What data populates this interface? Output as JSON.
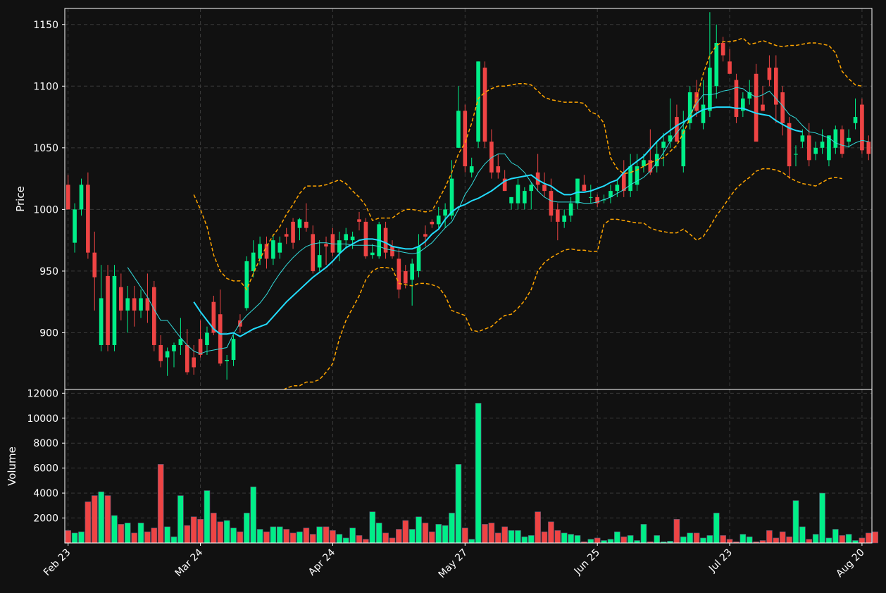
{
  "chart_data": {
    "type": "candlestick",
    "colors": {
      "background": "#111111",
      "up": "#00ee88",
      "down": "#ee4444",
      "grid": "#3a3a3a",
      "axis": "#ffffff",
      "sma_fast": "#33dddd",
      "sma_slow": "#22ddff",
      "bollinger": "#ffa500"
    },
    "price_panel": {
      "ylabel": "Price",
      "yticks": [
        900,
        950,
        1000,
        1050,
        1100,
        1150
      ],
      "ylim": [
        854,
        1163
      ]
    },
    "volume_panel": {
      "ylabel": "Volume",
      "yticks": [
        2000,
        4000,
        6000,
        8000,
        10000,
        12000
      ],
      "ylim": [
        0,
        12300
      ]
    },
    "xlim": [
      -0.5,
      121.5
    ],
    "x_ticks": [
      {
        "index": 0,
        "label": "Feb 23"
      },
      {
        "index": 20,
        "label": "Mar 24"
      },
      {
        "index": 40,
        "label": "Apr 24"
      },
      {
        "index": 60,
        "label": "May 27"
      },
      {
        "index": 80,
        "label": "Jun 25"
      },
      {
        "index": 100,
        "label": "Jul 23"
      },
      {
        "index": 120,
        "label": "Aug 20"
      }
    ],
    "candles": [
      [
        1020,
        1028,
        1000,
        1000
      ],
      [
        973,
        1005,
        965,
        1000
      ],
      [
        1000,
        1025,
        995,
        1020
      ],
      [
        1020,
        1030,
        960,
        965
      ],
      [
        965,
        982,
        918,
        945
      ],
      [
        890,
        955,
        885,
        928
      ],
      [
        946,
        955,
        885,
        890
      ],
      [
        890,
        955,
        885,
        946
      ],
      [
        937,
        948,
        910,
        918
      ],
      [
        918,
        938,
        900,
        928
      ],
      [
        928,
        938,
        905,
        918
      ],
      [
        918,
        935,
        912,
        928
      ],
      [
        928,
        948,
        908,
        918
      ],
      [
        937,
        942,
        885,
        890
      ],
      [
        890,
        898,
        872,
        877
      ],
      [
        880,
        888,
        865,
        885
      ],
      [
        885,
        892,
        872,
        890
      ],
      [
        890,
        912,
        882,
        895
      ],
      [
        890,
        903,
        866,
        868
      ],
      [
        880,
        890,
        866,
        872
      ],
      [
        895,
        910,
        880,
        882
      ],
      [
        890,
        905,
        882,
        900
      ],
      [
        925,
        930,
        898,
        900
      ],
      [
        915,
        935,
        873,
        875
      ],
      [
        877,
        882,
        862,
        878
      ],
      [
        878,
        898,
        873,
        895
      ],
      [
        910,
        915,
        900,
        905
      ],
      [
        920,
        962,
        918,
        958
      ],
      [
        950,
        975,
        945,
        965
      ],
      [
        960,
        978,
        955,
        972
      ],
      [
        972,
        978,
        952,
        960
      ],
      [
        960,
        980,
        955,
        975
      ],
      [
        965,
        978,
        960,
        973
      ],
      [
        980,
        985,
        972,
        978
      ],
      [
        990,
        993,
        968,
        973
      ],
      [
        985,
        993,
        975,
        992
      ],
      [
        990,
        1005,
        982,
        985
      ],
      [
        980,
        987,
        948,
        950
      ],
      [
        953,
        975,
        950,
        963
      ],
      [
        972,
        978,
        955,
        970
      ],
      [
        980,
        985,
        962,
        965
      ],
      [
        965,
        982,
        958,
        975
      ],
      [
        975,
        985,
        968,
        980
      ],
      [
        975,
        982,
        968,
        978
      ],
      [
        992,
        998,
        983,
        990
      ],
      [
        990,
        993,
        960,
        962
      ],
      [
        963,
        972,
        960,
        965
      ],
      [
        962,
        990,
        960,
        988
      ],
      [
        985,
        990,
        960,
        965
      ],
      [
        970,
        975,
        960,
        962
      ],
      [
        960,
        968,
        928,
        935
      ],
      [
        950,
        955,
        936,
        940
      ],
      [
        943,
        960,
        922,
        956
      ],
      [
        950,
        980,
        945,
        970
      ],
      [
        980,
        987,
        970,
        978
      ],
      [
        990,
        992,
        985,
        988
      ],
      [
        988,
        1002,
        985,
        995
      ],
      [
        995,
        1005,
        985,
        1000
      ],
      [
        995,
        1040,
        992,
        1025
      ],
      [
        1050,
        1100,
        1050,
        1080
      ],
      [
        1080,
        1085,
        1030,
        1035
      ],
      [
        1030,
        1042,
        1026,
        1035
      ],
      [
        1055,
        1120,
        1050,
        1120
      ],
      [
        1115,
        1120,
        1050,
        1055
      ],
      [
        1055,
        1065,
        1025,
        1030
      ],
      [
        1035,
        1045,
        1025,
        1030
      ],
      [
        1025,
        1032,
        1015,
        1015
      ],
      [
        1005,
        1010,
        1000,
        1010
      ],
      [
        1005,
        1025,
        1000,
        1020
      ],
      [
        1005,
        1018,
        1000,
        1015
      ],
      [
        1015,
        1022,
        1000,
        1020
      ],
      [
        1030,
        1045,
        1015,
        1020
      ],
      [
        1020,
        1030,
        1010,
        1015
      ],
      [
        1015,
        1025,
        990,
        995
      ],
      [
        1000,
        1005,
        975,
        990
      ],
      [
        990,
        1000,
        985,
        995
      ],
      [
        995,
        1010,
        990,
        1005
      ],
      [
        1005,
        1025,
        1000,
        1025
      ],
      [
        1020,
        1028,
        1015,
        1015
      ],
      [
        1010,
        1020,
        1005,
        1010
      ],
      [
        1010,
        1012,
        1002,
        1005
      ],
      [
        1008,
        1012,
        1005,
        1008
      ],
      [
        1010,
        1020,
        1005,
        1015
      ],
      [
        1015,
        1025,
        1010,
        1020
      ],
      [
        1030,
        1040,
        1010,
        1015
      ],
      [
        1015,
        1045,
        1010,
        1035
      ],
      [
        1020,
        1045,
        1015,
        1035
      ],
      [
        1035,
        1045,
        1030,
        1040
      ],
      [
        1040,
        1065,
        1028,
        1030
      ],
      [
        1035,
        1055,
        1030,
        1045
      ],
      [
        1050,
        1062,
        1035,
        1055
      ],
      [
        1055,
        1090,
        1050,
        1060
      ],
      [
        1075,
        1085,
        1055,
        1055
      ],
      [
        1035,
        1080,
        1030,
        1065
      ],
      [
        1070,
        1100,
        1065,
        1095
      ],
      [
        1095,
        1105,
        1075,
        1080
      ],
      [
        1070,
        1105,
        1065,
        1085
      ],
      [
        1080,
        1160,
        1075,
        1115
      ],
      [
        1100,
        1150,
        1090,
        1135
      ],
      [
        1135,
        1140,
        1120,
        1125
      ],
      [
        1120,
        1130,
        1110,
        1110
      ],
      [
        1105,
        1110,
        1070,
        1075
      ],
      [
        1080,
        1095,
        1075,
        1090
      ],
      [
        1090,
        1105,
        1085,
        1095
      ],
      [
        1110,
        1118,
        1055,
        1055
      ],
      [
        1085,
        1100,
        1080,
        1080
      ],
      [
        1115,
        1125,
        1100,
        1105
      ],
      [
        1115,
        1125,
        1070,
        1085
      ],
      [
        1095,
        1100,
        1060,
        1070
      ],
      [
        1070,
        1075,
        1025,
        1035
      ],
      [
        1045,
        1052,
        1035,
        1045
      ],
      [
        1055,
        1065,
        1050,
        1060
      ],
      [
        1060,
        1070,
        1035,
        1040
      ],
      [
        1045,
        1055,
        1040,
        1050
      ],
      [
        1050,
        1065,
        1045,
        1055
      ],
      [
        1040,
        1060,
        1035,
        1060
      ],
      [
        1050,
        1068,
        1045,
        1065
      ],
      [
        1065,
        1068,
        1042,
        1045
      ],
      [
        1055,
        1065,
        1050,
        1058
      ],
      [
        1070,
        1090,
        1065,
        1075
      ],
      [
        1085,
        1090,
        1045,
        1048
      ],
      [
        1055,
        1060,
        1040,
        1045
      ]
    ],
    "volume": [
      1000,
      800,
      900,
      3300,
      3800,
      4100,
      3800,
      2200,
      1500,
      1600,
      800,
      1600,
      900,
      1200,
      6300,
      1300,
      500,
      3800,
      1400,
      2100,
      1900,
      4200,
      2400,
      1700,
      1800,
      1200,
      900,
      2400,
      4500,
      1100,
      900,
      1300,
      1300,
      1100,
      800,
      900,
      1200,
      700,
      1300,
      1300,
      1000,
      700,
      400,
      1200,
      600,
      300,
      2500,
      1600,
      800,
      400,
      1100,
      1800,
      1100,
      2100,
      1600,
      900,
      1500,
      1400,
      2400,
      6300,
      1200,
      300,
      11200,
      1500,
      1600,
      800,
      1300,
      1000,
      1000,
      500,
      600,
      2500,
      900,
      1700,
      1000,
      800,
      700,
      600,
      100,
      300,
      400,
      200,
      300,
      900,
      500,
      600,
      200,
      1500,
      100,
      600,
      100,
      150,
      1900,
      500,
      800,
      800,
      400,
      600,
      2400,
      600,
      300,
      100,
      700,
      500,
      100,
      200,
      1000,
      400,
      900,
      500,
      3400,
      1300,
      300,
      700,
      4000,
      400,
      1100,
      600,
      700,
      200,
      400,
      800,
      900
    ],
    "sma_fast": [
      null,
      null,
      null,
      null,
      null,
      null,
      null,
      null,
      null,
      953,
      945,
      937,
      929,
      919,
      910,
      910,
      903,
      896,
      890,
      885,
      883,
      885,
      886,
      887,
      888,
      899,
      908,
      914,
      919,
      924,
      931,
      940,
      948,
      955,
      961,
      966,
      970,
      972,
      973,
      973,
      972,
      972,
      972,
      971,
      971,
      971,
      971,
      970,
      968,
      967,
      966,
      965,
      964,
      965,
      969,
      973,
      979,
      985,
      990,
      1000,
      1012,
      1020,
      1030,
      1037,
      1042,
      1045,
      1045,
      1038,
      1035,
      1030,
      1022,
      1015,
      1010,
      1007,
      1006,
      1006,
      1006,
      1006,
      1005,
      1005,
      1006,
      1008,
      1010,
      1013,
      1016,
      1020,
      1023,
      1026,
      1031,
      1038,
      1046,
      1055,
      1062,
      1069,
      1077,
      1086,
      1093,
      1093,
      1094,
      1096,
      1097,
      1099,
      1098,
      1094,
      1091,
      1093,
      1096,
      1090,
      1084,
      1077,
      1074,
      1068,
      1063,
      1062,
      1060,
      1058,
      1054,
      1052,
      1051,
      1054,
      1056,
      1055
    ],
    "sma_slow": [
      null,
      null,
      null,
      null,
      null,
      null,
      null,
      null,
      null,
      null,
      null,
      null,
      null,
      null,
      null,
      null,
      null,
      null,
      null,
      925,
      917,
      910,
      903,
      899,
      899,
      900,
      897,
      900,
      903,
      905,
      907,
      913,
      919,
      925,
      930,
      935,
      940,
      945,
      949,
      953,
      958,
      964,
      969,
      972,
      975,
      976,
      976,
      975,
      973,
      970,
      969,
      968,
      968,
      970,
      974,
      980,
      984,
      992,
      998,
      1002,
      1004,
      1007,
      1009,
      1012,
      1015,
      1019,
      1023,
      1025,
      1026,
      1027,
      1028,
      1024,
      1021,
      1019,
      1015,
      1012,
      1012,
      1014,
      1014,
      1015,
      1017,
      1019,
      1022,
      1024,
      1030,
      1035,
      1039,
      1043,
      1049,
      1055,
      1060,
      1064,
      1068,
      1071,
      1074,
      1078,
      1081,
      1082,
      1083,
      1083,
      1083,
      1082,
      1082,
      1080,
      1078,
      1077,
      1076,
      1072,
      1069,
      1066,
      1064,
      1063
    ],
    "boll_upper": [
      null,
      null,
      null,
      null,
      null,
      null,
      null,
      null,
      null,
      null,
      null,
      null,
      null,
      null,
      null,
      null,
      null,
      null,
      null,
      1012,
      1000,
      986,
      963,
      950,
      944,
      942,
      942,
      935,
      948,
      960,
      970,
      979,
      986,
      996,
      1004,
      1013,
      1019,
      1019,
      1019,
      1020,
      1022,
      1024,
      1021,
      1015,
      1010,
      1003,
      991,
      993,
      993,
      993,
      997,
      1000,
      1000,
      999,
      998,
      999,
      1008,
      1018,
      1030,
      1045,
      1054,
      1070,
      1090,
      1095,
      1098,
      1100,
      1100,
      1101,
      1102,
      1102,
      1101,
      1096,
      1091,
      1089,
      1088,
      1087,
      1087,
      1087,
      1086,
      1079,
      1077,
      1070,
      1042,
      1033,
      1029,
      1030,
      1032,
      1035,
      1038,
      1040,
      1042,
      1047,
      1052,
      1062,
      1074,
      1090,
      1110,
      1125,
      1133,
      1136,
      1136,
      1137,
      1139,
      1134,
      1135,
      1137,
      1135,
      1133,
      1132,
      1133,
      1133,
      1134,
      1135,
      1135,
      1134,
      1133,
      1127,
      1112,
      1106,
      1101,
      1100
    ],
    "boll_lower": [
      null,
      null,
      null,
      null,
      null,
      null,
      null,
      null,
      null,
      null,
      null,
      null,
      null,
      null,
      null,
      null,
      null,
      null,
      null,
      842,
      835,
      828,
      835,
      843,
      850,
      852,
      850,
      847,
      853,
      850,
      845,
      847,
      852,
      855,
      857,
      857,
      860,
      860,
      862,
      868,
      875,
      895,
      910,
      920,
      930,
      943,
      950,
      953,
      953,
      952,
      940,
      939,
      938,
      940,
      940,
      939,
      937,
      930,
      918,
      916,
      914,
      902,
      901,
      903,
      905,
      910,
      914,
      915,
      920,
      926,
      935,
      950,
      957,
      961,
      964,
      967,
      968,
      967,
      967,
      966,
      966,
      988,
      992,
      992,
      991,
      990,
      989,
      989,
      985,
      983,
      982,
      981,
      981,
      984,
      980,
      975,
      978,
      986,
      995,
      1002,
      1010,
      1017,
      1022,
      1026,
      1031,
      1033,
      1033,
      1032,
      1030,
      1026,
      1023,
      1021,
      1020,
      1019,
      1022,
      1025,
      1026,
      1025
    ]
  }
}
